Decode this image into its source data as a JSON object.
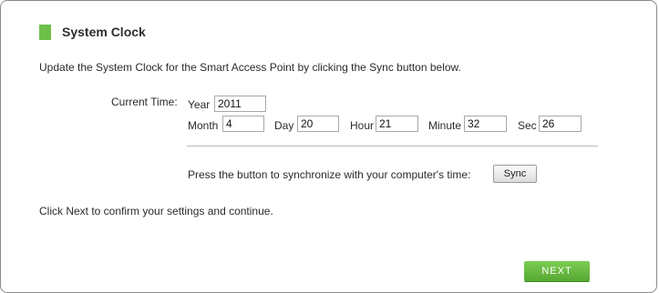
{
  "header": {
    "title": "System Clock"
  },
  "intro_text": "Update the System Clock for the Smart Access Point by clicking the Sync button below.",
  "current_time": {
    "label": "Current Time:",
    "year_label": "Year",
    "year_value": "2011",
    "month_label": "Month",
    "month_value": "4",
    "day_label": "Day",
    "day_value": "20",
    "hour_label": "Hour",
    "hour_value": "21",
    "minute_label": "Minute",
    "minute_value": "32",
    "sec_label": "Sec",
    "sec_value": "26"
  },
  "sync": {
    "prompt": "Press the button to synchronize with your computer's time:",
    "button_label": "Sync"
  },
  "footer_text": "Click Next to confirm your settings and continue.",
  "next_button_label": "NEXT",
  "colors": {
    "accent_green": "#6cc04a",
    "next_button": "#62b43f"
  }
}
